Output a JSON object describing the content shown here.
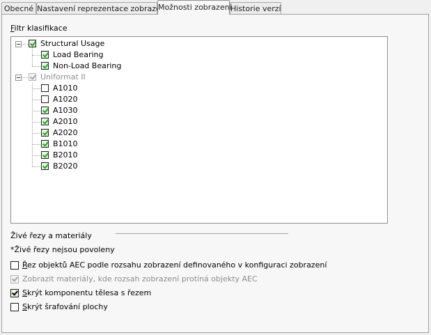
{
  "tabs": [
    {
      "label": "Obecné",
      "active": false
    },
    {
      "label": "Nastavení reprezentace zobrazení",
      "active": false
    },
    {
      "label": "Možnosti zobrazení",
      "active": true
    },
    {
      "label": "Historie verzí",
      "active": false
    }
  ],
  "filter": {
    "label_first": "F",
    "label_rest": "iltr klasifikace",
    "tree": [
      {
        "label": "Structural Usage",
        "checked": true,
        "disabled": false,
        "expanded": true,
        "children": [
          {
            "label": "Load Bearing",
            "checked": true
          },
          {
            "label": "Non-Load Bearing",
            "checked": true
          }
        ]
      },
      {
        "label": "Uniformat II",
        "checked": true,
        "disabled": true,
        "expanded": true,
        "children": [
          {
            "label": "A1010",
            "checked": false
          },
          {
            "label": "A1020",
            "checked": false
          },
          {
            "label": "A1030",
            "checked": true
          },
          {
            "label": "A2010",
            "checked": true
          },
          {
            "label": "A2020",
            "checked": true
          },
          {
            "label": "B1010",
            "checked": true
          },
          {
            "label": "B2010",
            "checked": true
          },
          {
            "label": "B2020",
            "checked": true
          }
        ]
      }
    ]
  },
  "live_sections": {
    "heading": "Živé řezy a materiály",
    "note": "*Živé řezy nejsou povoleny",
    "options": [
      {
        "mnemonic": "Ř",
        "rest": "ez objektů AEC podle rozsahu zobrazení definovaného v konfiguraci zobrazení",
        "checked": false,
        "disabled": false
      },
      {
        "mnemonic": "",
        "rest": "Zobrazit materiály, kde rozsah zobrazení protíná objekty AEC",
        "checked": true,
        "disabled": true
      },
      {
        "mnemonic": "S",
        "rest": "krýt komponentu tělesa s řezem",
        "checked": true,
        "disabled": false
      },
      {
        "mnemonic": "S",
        "rest": "krýt šrafování plochy",
        "checked": false,
        "disabled": false
      }
    ]
  }
}
